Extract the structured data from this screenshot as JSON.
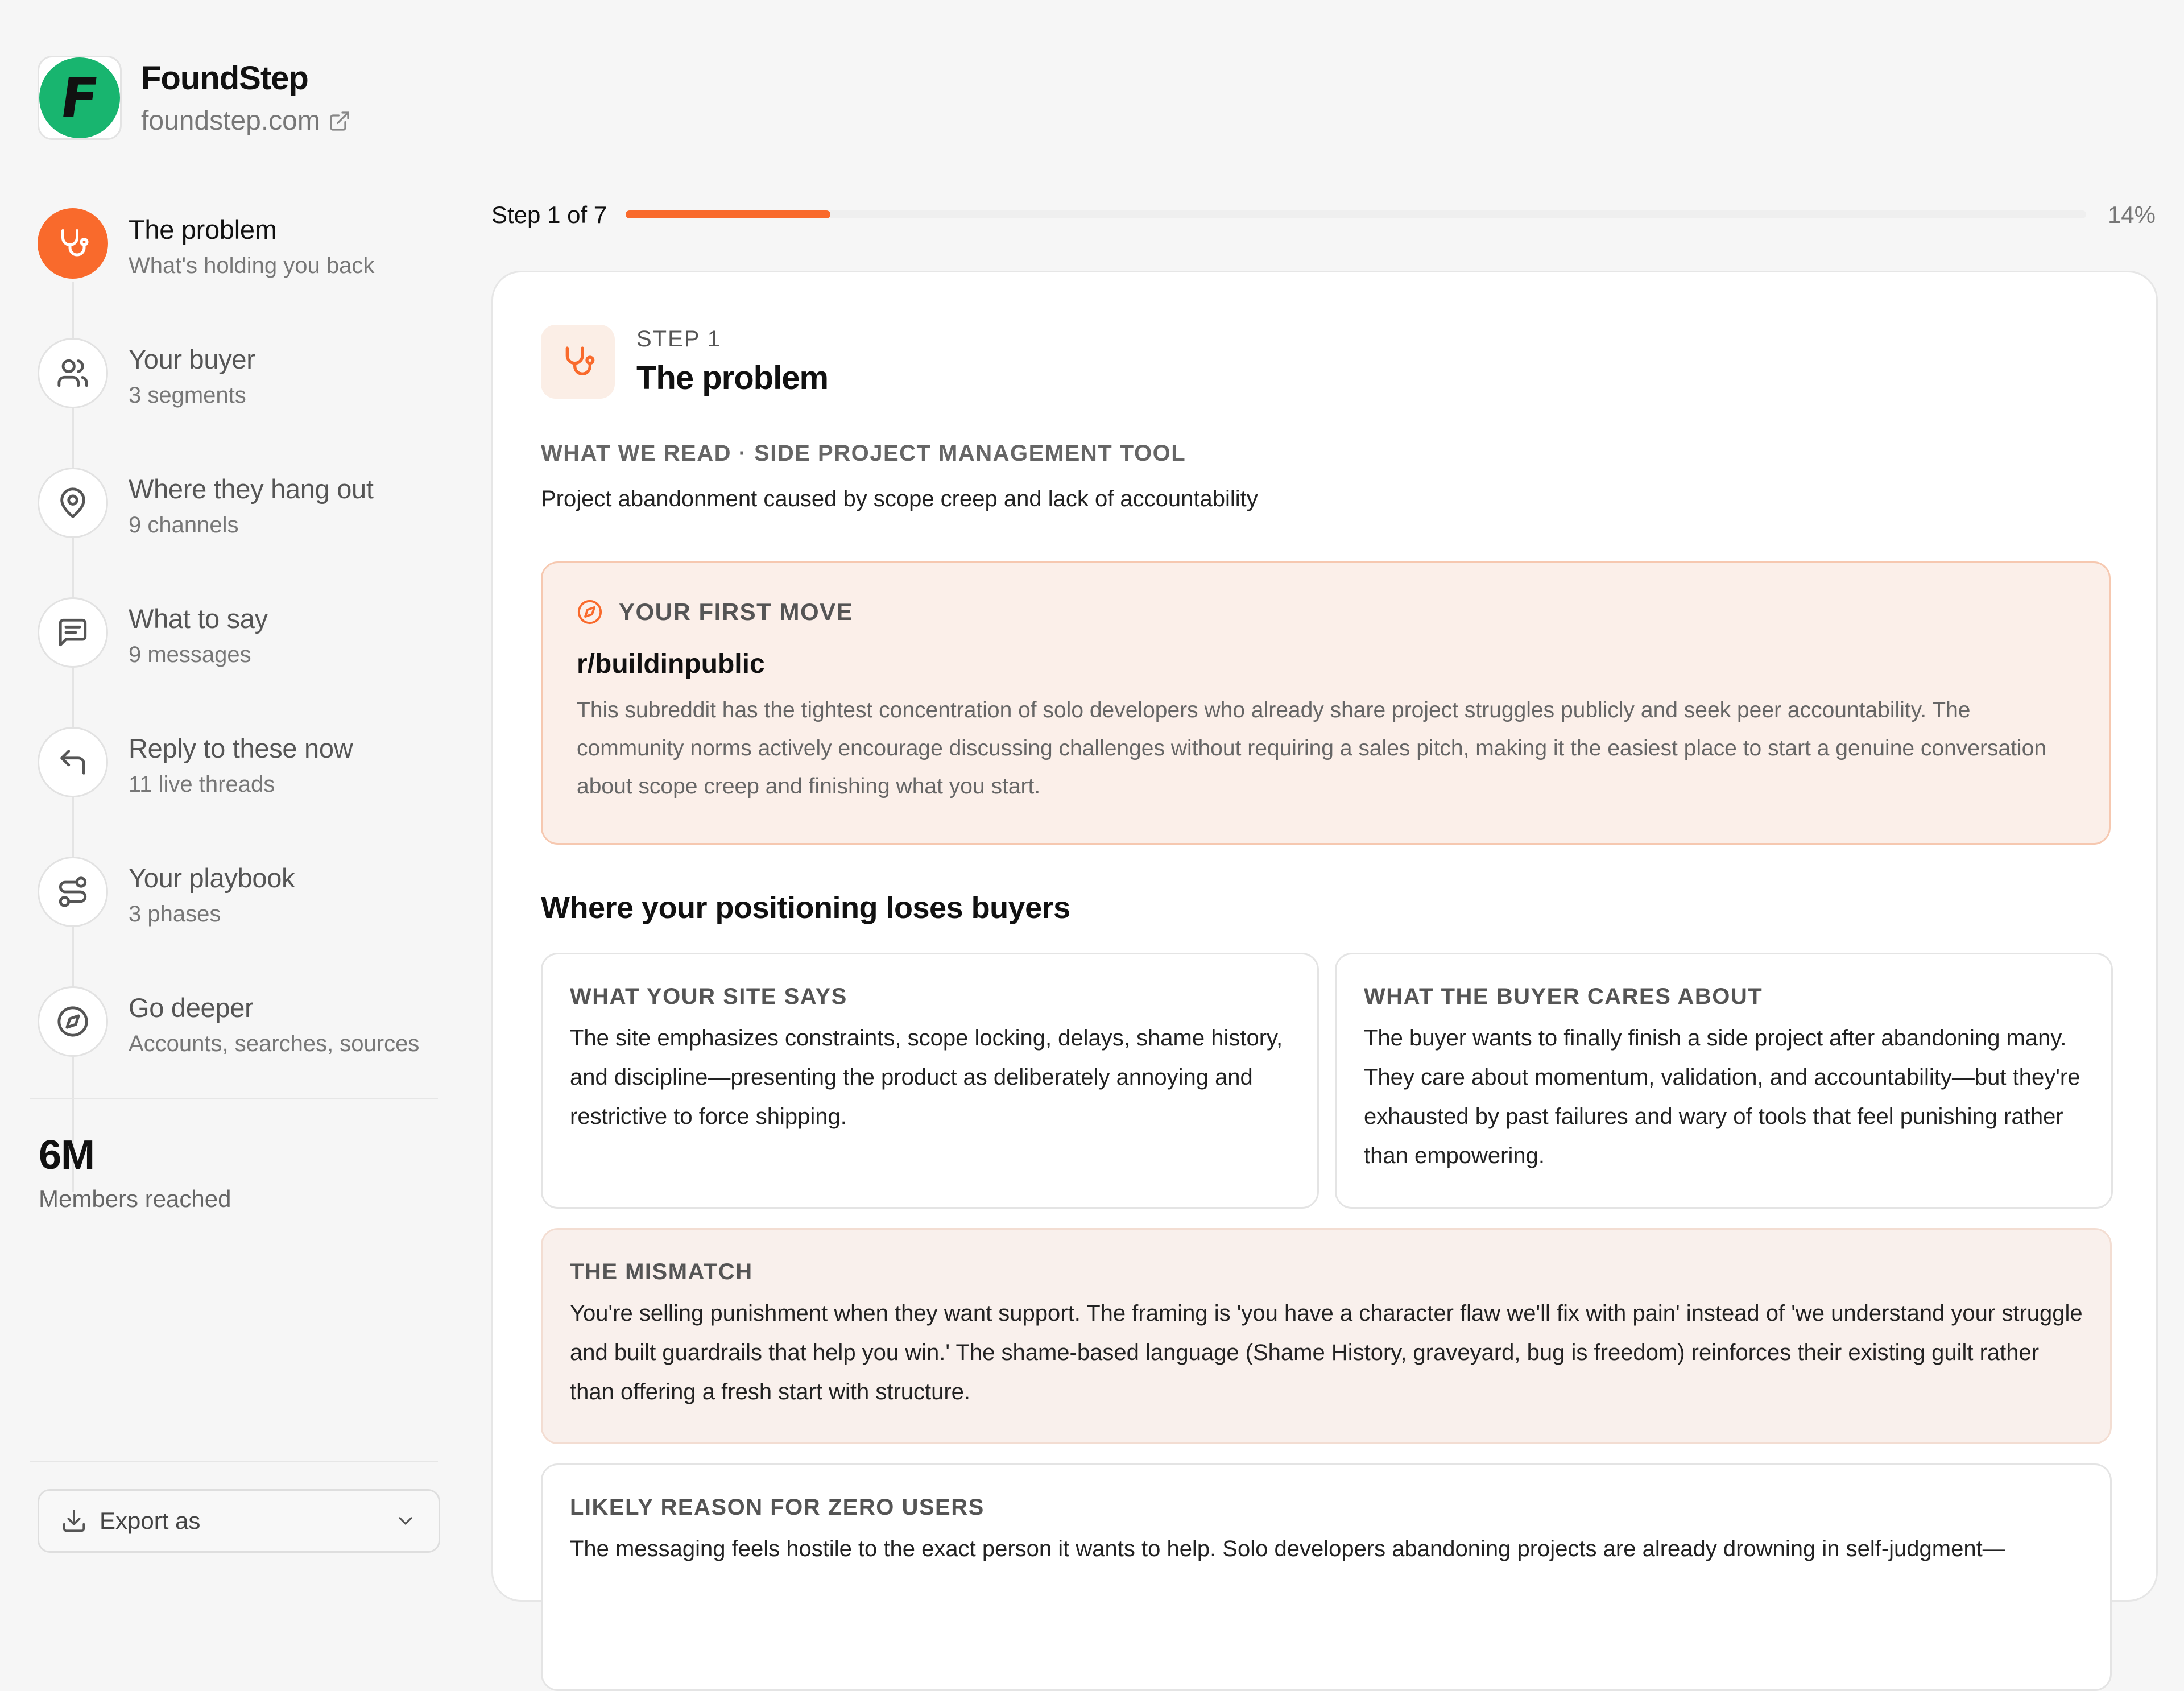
{
  "brand": {
    "name": "FoundStep",
    "logo_letter": "F",
    "url": "foundstep.com"
  },
  "steps": [
    {
      "title": "The problem",
      "sub": "What's holding you back",
      "icon": "stethoscope-icon",
      "active": true
    },
    {
      "title": "Your buyer",
      "sub": "3 segments",
      "icon": "users-icon"
    },
    {
      "title": "Where they hang out",
      "sub": "9 channels",
      "icon": "map-pin-icon"
    },
    {
      "title": "What to say",
      "sub": "9 messages",
      "icon": "message-icon"
    },
    {
      "title": "Reply to these now",
      "sub": "11 live threads",
      "icon": "reply-icon"
    },
    {
      "title": "Your playbook",
      "sub": "3 phases",
      "icon": "route-icon"
    },
    {
      "title": "Go deeper",
      "sub": "Accounts, searches, sources",
      "icon": "compass-icon"
    }
  ],
  "reach": {
    "value": "6M",
    "label": "Members reached"
  },
  "export": {
    "label": "Export as"
  },
  "progress": {
    "label": "Step 1 of 7",
    "percent_label": "14%",
    "fraction": 0.14
  },
  "card": {
    "kicker": "STEP 1",
    "title": "The problem",
    "read_label": "WHAT WE READ · SIDE PROJECT MANAGEMENT TOOL",
    "read_text": "Project abandonment caused by scope creep and lack of accountability",
    "first_move": {
      "label": "YOUR FIRST MOVE",
      "title": "r/buildinpublic",
      "body": "This subreddit has the tightest concentration of solo developers who already share project struggles publicly and seek peer accountability. The community norms actively encourage discussing challenges without requiring a sales pitch, making it the easiest place to start a genuine conversation about scope creep and finishing what you start."
    },
    "section_title": "Where your positioning loses buyers",
    "site_says": {
      "label": "WHAT YOUR SITE SAYS",
      "body": "The site emphasizes constraints, scope locking, delays, shame history, and discipline—presenting the product as deliberately annoying and restrictive to force shipping."
    },
    "buyer_cares": {
      "label": "WHAT THE BUYER CARES ABOUT",
      "body": "The buyer wants to finally finish a side project after abandoning many. They care about momentum, validation, and accountability—but they're exhausted by past failures and wary of tools that feel punishing rather than empowering."
    },
    "mismatch": {
      "label": "THE MISMATCH",
      "body": "You're selling punishment when they want support. The framing is 'you have a character flaw we'll fix with pain' instead of 'we understand your struggle and built guardrails that help you win.' The shame-based language (Shame History, graveyard, bug is freedom) reinforces their existing guilt rather than offering a fresh start with structure."
    },
    "reason": {
      "label": "LIKELY REASON FOR ZERO USERS",
      "body": "The messaging feels hostile to the exact person it wants to help. Solo developers abandoning projects are already drowning in self-judgment—"
    }
  },
  "colors": {
    "accent": "#f96a2c",
    "brand_green": "#18b56f",
    "callout_bg": "#fbefe9"
  }
}
